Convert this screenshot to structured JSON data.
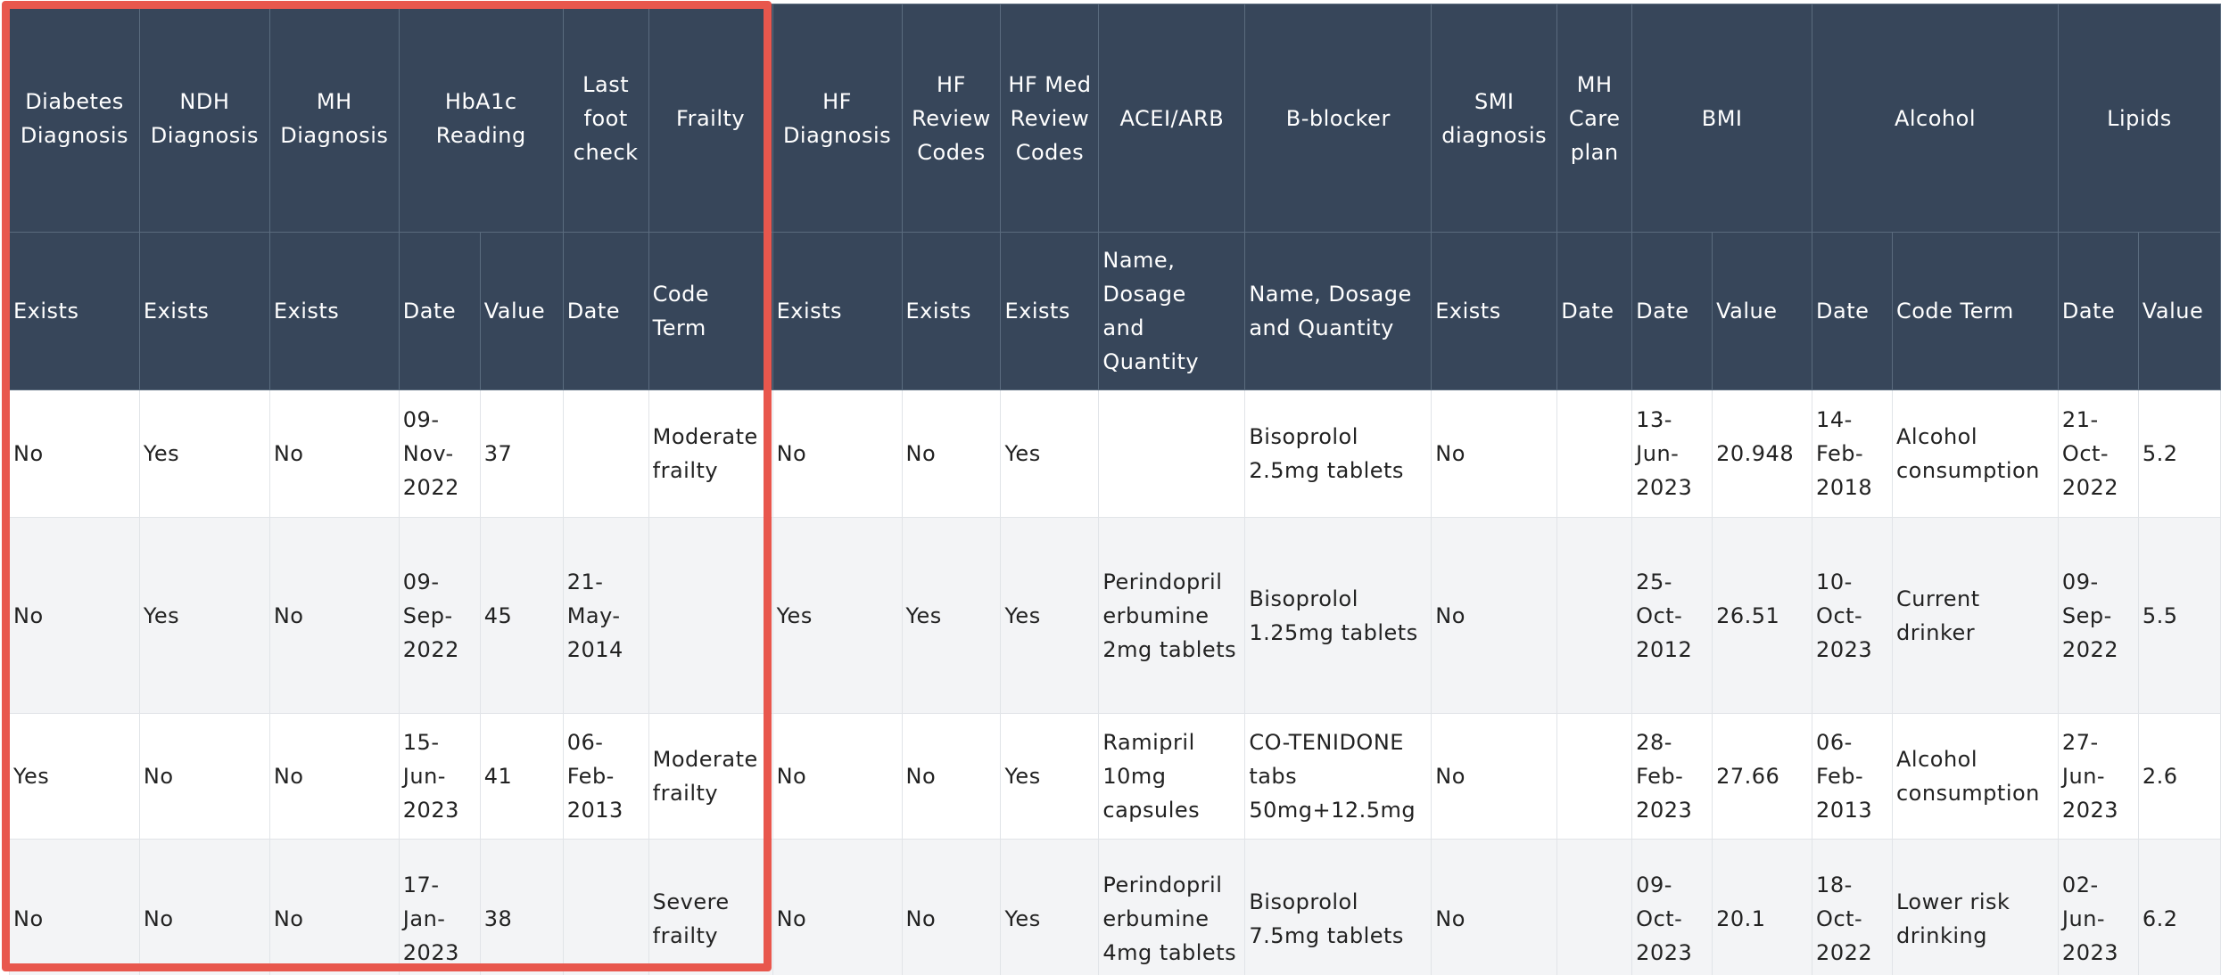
{
  "table": {
    "groups": [
      {
        "label": "Diabetes Diagnosis",
        "span": 1
      },
      {
        "label": "NDH Diagnosis",
        "span": 1
      },
      {
        "label": "MH Diagnosis",
        "span": 1
      },
      {
        "label": "HbA1c Reading",
        "span": 2
      },
      {
        "label": "Last foot check",
        "span": 1
      },
      {
        "label": "Frailty",
        "span": 1
      },
      {
        "label": "HF Diagnosis",
        "span": 1
      },
      {
        "label": "HF Review Codes",
        "span": 1
      },
      {
        "label": "HF Med Review Codes",
        "span": 1
      },
      {
        "label": "ACEI/ARB",
        "span": 1
      },
      {
        "label": "B-blocker",
        "span": 1
      },
      {
        "label": "SMI diagnosis",
        "span": 1
      },
      {
        "label": "MH Care plan",
        "span": 1
      },
      {
        "label": "BMI",
        "span": 2
      },
      {
        "label": "Alcohol",
        "span": 2
      },
      {
        "label": "Lipids",
        "span": 2
      }
    ],
    "subheaders": [
      "Exists",
      "Exists",
      "Exists",
      "Date",
      "Value",
      "Date",
      "Code Term",
      "Exists",
      "Exists",
      "Exists",
      "Name, Dosage and Quantity",
      "Name, Dosage and Quantity",
      "Exists",
      "Date",
      "Date",
      "Value",
      "Date",
      "Code Term",
      "Date",
      "Value"
    ],
    "rows": [
      [
        "No",
        "Yes",
        "No",
        "09-Nov-2022",
        "37",
        "",
        "Moderate frailty",
        "No",
        "No",
        "Yes",
        "",
        "Bisoprolol 2.5mg tablets",
        "No",
        "",
        "13-Jun-2023",
        "20.948",
        "14-Feb-2018",
        "Alcohol consumption",
        "21-Oct-2022",
        "5.2"
      ],
      [
        "No",
        "Yes",
        "No",
        "09-Sep-2022",
        "45",
        "21-May-2014",
        "",
        "Yes",
        "Yes",
        "Yes",
        "Perindopril erbumine 2mg tablets",
        "Bisoprolol 1.25mg tablets",
        "No",
        "",
        "25-Oct-2012",
        "26.51",
        "10-Oct-2023",
        "Current drinker",
        "09-Sep-2022",
        "5.5"
      ],
      [
        "Yes",
        "No",
        "No",
        "15-Jun-2023",
        "41",
        "06-Feb-2013",
        "Moderate frailty",
        "No",
        "No",
        "Yes",
        "Ramipril 10mg capsules",
        "CO-TENIDONE tabs 50mg+12.5mg",
        "No",
        "",
        "28-Feb-2023",
        "27.66",
        "06-Feb-2013",
        "Alcohol consumption",
        "27-Jun-2023",
        "2.6"
      ],
      [
        "No",
        "No",
        "No",
        "17-Jan-2023",
        "38",
        "",
        "Severe frailty",
        "No",
        "No",
        "Yes",
        "Perindopril erbumine 4mg tablets",
        "Bisoprolol 7.5mg tablets",
        "No",
        "",
        "09-Oct-2023",
        "20.1",
        "18-Oct-2022",
        "Lower risk drinking",
        "02-Jun-2023",
        "6.2"
      ]
    ]
  },
  "highlight": {
    "color": "#e8574d"
  }
}
